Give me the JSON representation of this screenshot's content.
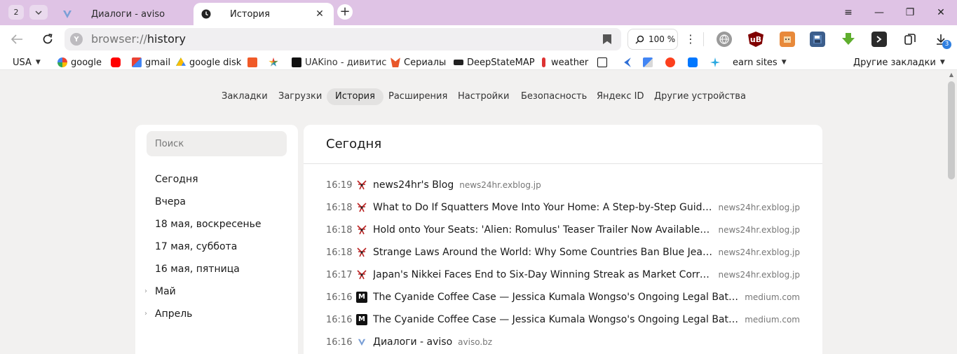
{
  "tabstrip": {
    "tab_count": "2",
    "tabs": [
      {
        "title": "Диалоги - aviso",
        "icon": "aviso-v-icon"
      },
      {
        "title": "История",
        "icon": "history-clock-icon"
      }
    ],
    "close_glyph": "✕",
    "new_tab_glyph": "+",
    "window_controls": {
      "menu": "≡",
      "minimize": "—",
      "restore": "❐",
      "close": "✕"
    }
  },
  "toolbar": {
    "url_scheme": "browser://",
    "url_path": "history",
    "zoom": "100 %",
    "downloads_badge": "3"
  },
  "bookmarks": {
    "items": [
      {
        "label": "USA",
        "dropdown": true
      },
      {
        "label": "google"
      },
      {
        "label": "gmail"
      },
      {
        "label": "google disk"
      },
      {
        "label": ""
      },
      {
        "label": ""
      },
      {
        "label": "UAKino - дивитис"
      },
      {
        "label": "Сериалы"
      },
      {
        "label": "DeepStateMAP"
      },
      {
        "label": "weather"
      },
      {
        "label": "earn sites",
        "dropdown": true
      }
    ],
    "other": "Другие закладки"
  },
  "page_nav": {
    "tabs": [
      "Закладки",
      "Загрузки",
      "История",
      "Расширения",
      "Настройки",
      "Безопасность",
      "Яндекс ID",
      "Другие устройства"
    ],
    "active": "История"
  },
  "sidebar": {
    "search_placeholder": "Поиск",
    "items": [
      {
        "label": "Сегодня"
      },
      {
        "label": "Вчера"
      },
      {
        "label": "18 мая, воскресенье"
      },
      {
        "label": "17 мая, суббота"
      },
      {
        "label": "16 мая, пятница"
      },
      {
        "label": "Май",
        "expandable": true
      },
      {
        "label": "Апрель",
        "expandable": true
      }
    ]
  },
  "history": {
    "heading": "Сегодня",
    "entries": [
      {
        "time": "16:19",
        "title": "news24hr's Blog",
        "domain": "news24hr.exblog.jp",
        "icon": "exblog-icon"
      },
      {
        "time": "16:18",
        "title": "What to Do If Squatters Move Into Your Home: A Step-by-Step Guide : ...",
        "domain": "news24hr.exblog.jp",
        "icon": "exblog-icon"
      },
      {
        "time": "16:18",
        "title": "Hold onto Your Seats: 'Alien: Romulus' Teaser Trailer Now Available : ne...",
        "domain": "news24hr.exblog.jp",
        "icon": "exblog-icon"
      },
      {
        "time": "16:18",
        "title": "Strange Laws Around the World: Why Some Countries Ban Blue Jeans ...",
        "domain": "news24hr.exblog.jp",
        "icon": "exblog-icon"
      },
      {
        "time": "16:17",
        "title": "Japan's Nikkei Faces End to Six-Day Winning Streak as Market Corrects...",
        "domain": "news24hr.exblog.jp",
        "icon": "exblog-icon"
      },
      {
        "time": "16:16",
        "title": "The Cyanide Coffee Case — Jessica Kumala Wongso's Ongoing Legal Battle |...",
        "domain": "medium.com",
        "icon": "medium-icon"
      },
      {
        "time": "16:16",
        "title": "The Cyanide Coffee Case — Jessica Kumala Wongso's Ongoing Legal Battle |...",
        "domain": "medium.com",
        "icon": "medium-icon"
      },
      {
        "time": "16:16",
        "title": "Диалоги - aviso",
        "domain": "aviso.bz",
        "icon": "aviso-v-icon"
      }
    ]
  },
  "colors": {
    "tabstrip_bg": "#dfc3e5",
    "page_bg": "#f2f1f0",
    "card_bg": "#ffffff"
  }
}
